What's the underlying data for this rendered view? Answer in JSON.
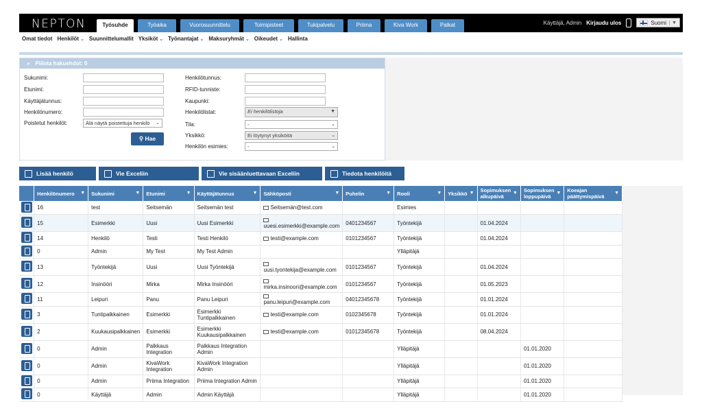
{
  "app": {
    "logo": "NEPTON"
  },
  "tabs": [
    "Työsuhde",
    "Työaika",
    "Vuorosuunnittelu",
    "Toimipisteet",
    "Tukipalvelu",
    "Priima",
    "Kiva Work",
    "Palkat"
  ],
  "user": {
    "label": "Käyttäjä, Admin",
    "logout": "Kirjaudu ulos",
    "language": "Suomi"
  },
  "subnav": [
    {
      "label": "Omat tiedot",
      "chev": false
    },
    {
      "label": "Henkilöt",
      "chev": true
    },
    {
      "label": "Suunnittelumallit",
      "chev": false
    },
    {
      "label": "Yksiköt",
      "chev": true
    },
    {
      "label": "Työnantajat",
      "chev": true
    },
    {
      "label": "Maksuryhmät",
      "chev": true
    },
    {
      "label": "Oikeudet",
      "chev": true
    },
    {
      "label": "Hallinta",
      "chev": false
    }
  ],
  "search": {
    "header": "Piilota hakuehdot: 0",
    "left_labels": [
      "Sukunimi:",
      "Etunimi:",
      "Käyttäjätunnus:",
      "Henkilönumero:",
      "Poistetut henkilöt:"
    ],
    "deleted_select": "Älä näytä poistettuja henkilö",
    "right_labels": [
      "Henkilötunnus:",
      "RFID-tunniste:",
      "Kaupunki:",
      "Henkilölistat:",
      "Tila:",
      "Yksikkö:",
      "Henkilön esimies:"
    ],
    "lists_select": "Ei henkilölistoja",
    "state_select": "-",
    "unit_select": "Ei löytynyt yksiköitä",
    "supervisor_select": "-",
    "search_button": "Hae"
  },
  "actions": [
    "Lisää henkilö",
    "Vie Exceliin",
    "Vie sisäänluettavaan Exceliin",
    "Tiedota henkilöitä"
  ],
  "table": {
    "columns": [
      "Henkilönumero",
      "Sukunimi",
      "Etunimi",
      "Käyttäjätunnus",
      "Sähköposti",
      "Puhelin",
      "Rooli",
      "Yksikkö",
      "Sopimuksen alkupäivä",
      "Sopimuksen loppupäivä",
      "Koeajan päättymispäivä"
    ],
    "rows": [
      [
        "16",
        "test",
        "Seitsemän",
        "Seitsemän test",
        "Seitsemän@test.com",
        "",
        "Esimies",
        "",
        "",
        "",
        ""
      ],
      [
        "15",
        "Esimerkki",
        "Uusi",
        "Uusi Esimerkki",
        "uuesi.esimerkki@example.com",
        "0401234567",
        "Työntekijä",
        "",
        "01.04.2024",
        "",
        ""
      ],
      [
        "14",
        "Henkilö",
        "Testi",
        "Testi Henkilö",
        "testi@example.com",
        "0101234567",
        "Työntekijä",
        "",
        "01.04.2024",
        "",
        ""
      ],
      [
        "0",
        "Admin",
        "My Test",
        "My Test Admin",
        "",
        "",
        "Ylläpitäjä",
        "",
        "",
        "",
        ""
      ],
      [
        "13",
        "Työntekijä",
        "Uusi",
        "Uusi Työntekijä",
        "uusi.tyontekija@example.com",
        "0101234567",
        "Työntekijä",
        "",
        "01.04.2024",
        "",
        ""
      ],
      [
        "12",
        "Insinööri",
        "Mirka",
        "Mirka Insinööri",
        "mirka.insinoori@example.com",
        "0101234567",
        "Työntekijä",
        "",
        "01.05.2023",
        "",
        ""
      ],
      [
        "11",
        "Leipuri",
        "Panu",
        "Panu Leipuri",
        "panu.leipuri@example.com",
        "04012345678",
        "Työntekijä",
        "",
        "01.01.2024",
        "",
        ""
      ],
      [
        "3",
        "Tuntipalkkainen",
        "Esimerkki",
        "Esimerkki Tuntipalkkainen",
        "testi@example.com",
        "0102345678",
        "Työntekijä",
        "",
        "01.01.2024",
        "",
        ""
      ],
      [
        "2",
        "Kuukausipalkkainen",
        "Esimerkki",
        "Esimerkki Kuukausipalkkainen",
        "testi@example.com",
        "01012345678",
        "Työntekijä",
        "",
        "08.04.2024",
        "",
        ""
      ],
      [
        "0",
        "Admin",
        "Palkkaus Integration",
        "Palkkaus Integration Admin",
        "",
        "",
        "Ylläpitäjä",
        "",
        "",
        "01.01.2020",
        ""
      ],
      [
        "0",
        "Admin",
        "KivaWork Integration",
        "KivaWork Integration Admin",
        "",
        "",
        "Ylläpitäjä",
        "",
        "",
        "01.01.2020",
        ""
      ],
      [
        "0",
        "Admin",
        "Priima Integration",
        "Priima Integration Admin",
        "",
        "",
        "Ylläpitäjä",
        "",
        "",
        "01.01.2020",
        ""
      ],
      [
        "0",
        "Käyttäjä",
        "Admin",
        "Admin Käyttäjä",
        "",
        "",
        "Ylläpitäjä",
        "",
        "",
        "01.01.2020",
        ""
      ]
    ]
  }
}
